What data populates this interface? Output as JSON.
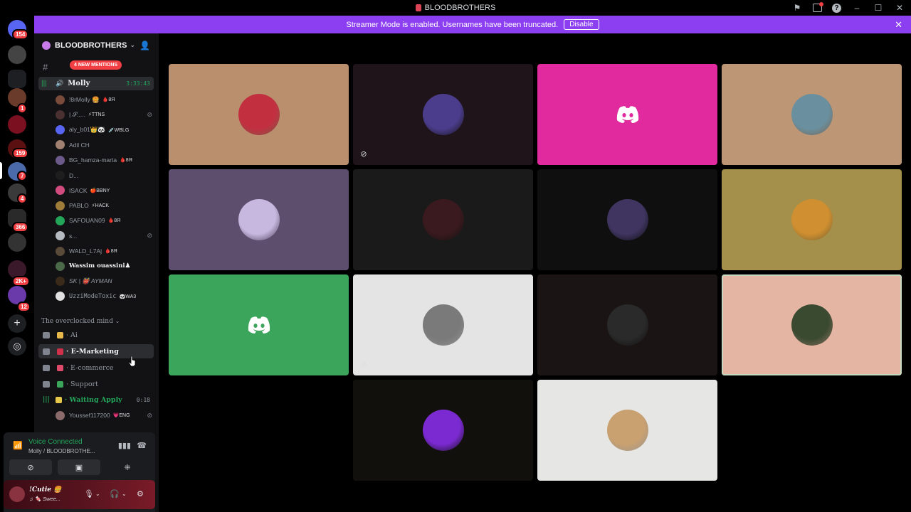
{
  "window": {
    "title": "BLOODBROTHERS"
  },
  "guild_rail": {
    "badges": [
      "154",
      "1",
      "159",
      "7",
      "4",
      "366",
      "2K+",
      "12"
    ]
  },
  "banner": {
    "message": "Streamer Mode is enabled. Usernames have been truncated.",
    "button": "Disable"
  },
  "server": {
    "name": "BLOODBROTHERS",
    "new_mentions": "4 NEW MENTIONS"
  },
  "voice_channel": {
    "name": "Molly",
    "duration": "3:33:43"
  },
  "members": [
    {
      "name": "!8rMolly 🍔",
      "tag": "🩸8Я",
      "color": "#7a4a3a"
    },
    {
      "name": "| 𝓢.....",
      "tag": "⚡TTNS",
      "color": "#4a3030",
      "muted": true
    },
    {
      "name": "aly_b01👑🐼",
      "tag": "💉WBLG",
      "color": "#5865f2"
    },
    {
      "name": "Adil CH",
      "tag": "",
      "color": "#a08070"
    },
    {
      "name": "BG_hamza-marta",
      "tag": "🩸8Я",
      "color": "#6c5a8a"
    },
    {
      "name": "D...",
      "tag": "",
      "color": "#1e1e1e"
    },
    {
      "name": "ISACK",
      "tag": "🍎BBNY",
      "color": "#d14b7e"
    },
    {
      "name": "PABLO",
      "tag": "⚡HACK",
      "color": "#a07c3a"
    },
    {
      "name": "SAFOUAN09",
      "tag": "🩸8Я",
      "color": "#23a55a"
    },
    {
      "name": "s...",
      "tag": "",
      "color": "#b5bac1",
      "muted": true
    },
    {
      "name": "WALD_L7Aj",
      "tag": "🩸8Я",
      "color": "#5a4a3a"
    },
    {
      "name": "Wassim ouassini♟",
      "tag": "",
      "color": "#4a6a4a",
      "bold": true
    },
    {
      "name": "SK | 👹 AYMAN",
      "tag": "",
      "color": "#3a2a1a",
      "italic": true
    },
    {
      "name": "UzziModeToxic",
      "tag": "🐼WA3",
      "color": "#e0e0e0"
    }
  ],
  "category": {
    "name": "The overclocked mind"
  },
  "channels": [
    {
      "name": "Ai"
    },
    {
      "name": "E-Marketing"
    },
    {
      "name": "E-commerce"
    },
    {
      "name": "Support"
    },
    {
      "name": "Waiting Apply",
      "duration": "0:18"
    }
  ],
  "waiting_member": {
    "name": "Youssef117200",
    "tag": "💗ENG"
  },
  "voice_panel": {
    "status": "Voice Connected",
    "location": "Molly / BLOODBROTHE..."
  },
  "user_panel": {
    "name": "!Cutie 🍔",
    "status": "♫ 🍬 Swee..."
  },
  "tiles": [
    {
      "bg": "#b98f6e",
      "avatar": "#c23040",
      "kind": "avatar"
    },
    {
      "bg": "#1f1419",
      "avatar": "#4b3d8c",
      "kind": "avatar",
      "muted": true
    },
    {
      "bg": "#e02a9e",
      "kind": "discord"
    },
    {
      "bg": "#bd9675",
      "avatar": "#6a90a0",
      "kind": "avatar"
    },
    {
      "bg": "#5d4e6e",
      "avatar": "#c7b8e0",
      "kind": "avatar"
    },
    {
      "bg": "#1a1a1a",
      "avatar": "#3a1a1e",
      "kind": "avatar"
    },
    {
      "bg": "#0f0f0f",
      "avatar": "#3f3560",
      "kind": "avatar"
    },
    {
      "bg": "#a48f4b",
      "avatar": "#d08f30",
      "kind": "avatar"
    },
    {
      "bg": "#3ba55c",
      "kind": "discord"
    },
    {
      "bg": "#e4e4e4",
      "avatar": "#7a7a7a",
      "kind": "avatar",
      "muted": true
    },
    {
      "bg": "#1a1414",
      "avatar": "#2a2a2a",
      "kind": "avatar"
    },
    {
      "bg": "#e3b5a2",
      "avatar": "#3a4a30",
      "kind": "avatar",
      "speaking": true
    },
    {
      "bg": "#12100c",
      "avatar": "#7a2ad0",
      "kind": "avatar"
    },
    {
      "bg": "#e6e6e4",
      "avatar": "#c9a070",
      "kind": "avatar"
    }
  ]
}
